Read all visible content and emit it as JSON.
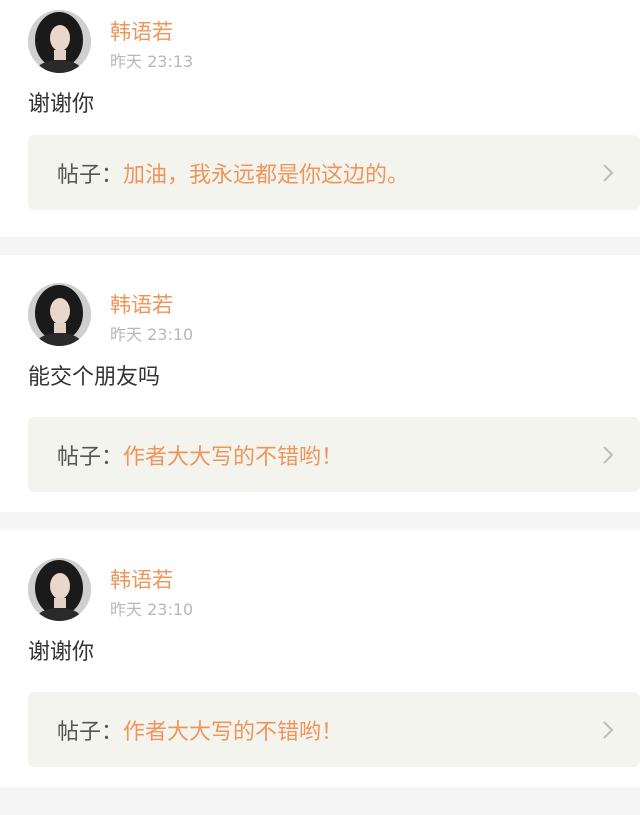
{
  "comments": [
    {
      "author": "韩语若",
      "time": "昨天 23:13",
      "message": "谢谢你",
      "post_prefix": "帖子：",
      "post_title": "加油，我永远都是你这边的。",
      "avatar_icon": "user-avatar-photo",
      "chevron_icon": "chevron-right-icon"
    },
    {
      "author": "韩语若",
      "time": "昨天 23:10",
      "message": "能交个朋友吗",
      "post_prefix": "帖子：",
      "post_title": "作者大大写的不错哟！",
      "avatar_icon": "user-avatar-photo",
      "chevron_icon": "chevron-right-icon"
    },
    {
      "author": "韩语若",
      "time": "昨天 23:10",
      "message": "谢谢你",
      "post_prefix": "帖子：",
      "post_title": "作者大大写的不错哟！",
      "avatar_icon": "user-avatar-photo",
      "chevron_icon": "chevron-right-icon"
    }
  ],
  "colors": {
    "accent": "#f0955a",
    "text": "#333333",
    "meta": "#b8b8b8",
    "link_bg": "#f4f4ef",
    "page_bg": "#f5f5f5"
  }
}
